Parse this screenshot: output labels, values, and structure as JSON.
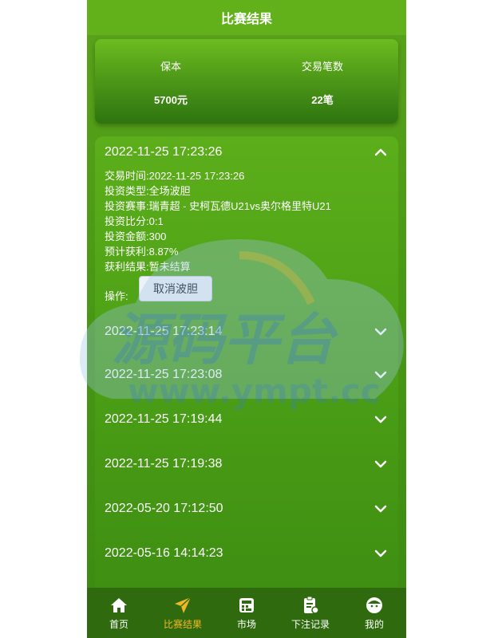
{
  "header": {
    "title": "比赛结果"
  },
  "summary": {
    "principal_label": "保本",
    "principal_value": "5700元",
    "trades_label": "交易笔数",
    "trades_value": "22笔"
  },
  "expanded": {
    "datetime": "2022-11-25 17:23:26",
    "lines": [
      "交易时间:2022-11-25 17:23:26",
      "投资类型:全场波胆",
      "投资赛事:瑞青超 - 史柯瓦德U21vs奥尔格里特U21",
      "投资比分:0:1",
      "投资金额:300",
      "预计获利:8.87%",
      "获利结果:暂未结算"
    ],
    "op_label": "操作:",
    "cancel_label": "取消波胆"
  },
  "records": [
    "2022-11-25 17:23:14",
    "2022-11-25 17:23:08",
    "2022-11-25 17:19:44",
    "2022-11-25 17:19:38",
    "2022-05-20 17:12:50",
    "2022-05-16 14:14:23"
  ],
  "watermark": {
    "brand": "源码平台",
    "url": "www.ympt.cc"
  },
  "tabs": [
    {
      "label": "首页",
      "icon": "home-icon",
      "active": false
    },
    {
      "label": "比赛结果",
      "icon": "paper-plane-icon",
      "active": true
    },
    {
      "label": "市场",
      "icon": "market-icon",
      "active": false
    },
    {
      "label": "下注记录",
      "icon": "clipboard-icon",
      "active": false
    },
    {
      "label": "我的",
      "icon": "profile-face-icon",
      "active": false
    }
  ],
  "colors": {
    "active_tab": "#f3b624",
    "tabbar_bg": "#2f6b0e",
    "accent_green": "#62b01a"
  }
}
